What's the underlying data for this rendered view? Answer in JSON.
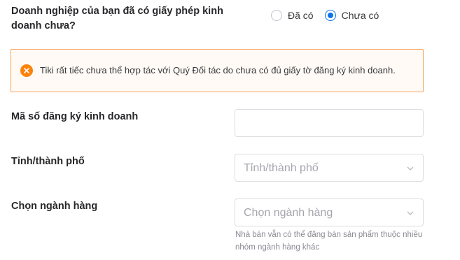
{
  "license_question": {
    "label": "Doanh nghiệp của bạn đã có giấy phép kinh doanh chưa?",
    "options": [
      {
        "label": "Đã có",
        "checked": false
      },
      {
        "label": "Chưa có",
        "checked": true
      }
    ]
  },
  "alert": {
    "icon": "close-circle-icon",
    "color": "#fc820a",
    "message": "Tiki rất tiếc chưa thể hợp tác với Quý Đối tác do chưa có đủ giấy tờ đăng ký kinh doanh."
  },
  "form": {
    "business_code": {
      "label": "Mã số đăng ký kinh doanh",
      "value": ""
    },
    "province": {
      "label": "Tỉnh/thành phố",
      "placeholder": "Tỉnh/thành phố",
      "icon": "chevron-down-icon"
    },
    "category": {
      "label": "Chọn ngành hàng",
      "placeholder": "Chọn ngành hàng",
      "icon": "chevron-down-icon",
      "hint": "Nhà bán vẫn có thể đăng bán sản phẩm thuộc nhiều nhóm ngành hàng khác"
    }
  },
  "colors": {
    "accent": "#0b74e5",
    "warning": "#fc820a",
    "warning_border": "#f5a35b"
  }
}
